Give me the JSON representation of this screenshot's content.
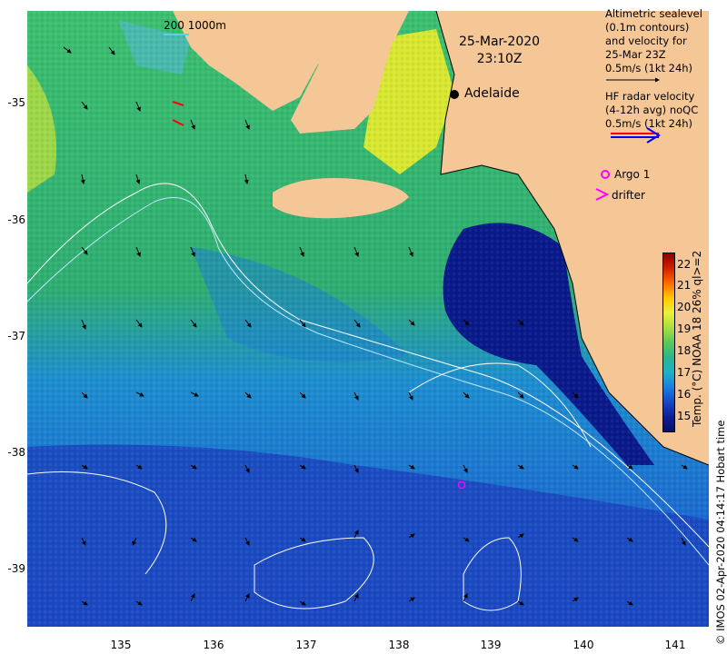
{
  "map": {
    "date": "25-Mar-2020",
    "time": "23:10Z",
    "city": "Adelaide",
    "scale_text": "200  1000m",
    "legend": {
      "altimetry_lines": [
        "Altimetric sealevel",
        "(0.1m contours)",
        "and velocity for",
        "25-Mar 23Z",
        "0.5m/s (1kt 24h)"
      ],
      "hf_lines": [
        "HF radar velocity",
        "(4-12h avg) noQC",
        "0.5m/s (1kt 24h)"
      ],
      "argo_label": "Argo 1",
      "drifter_label": "drifter"
    },
    "colorbar": {
      "title": "Temp. (°C) NOAA 18 26% ql>=2",
      "ticks": [
        "22",
        "21",
        "20",
        "19",
        "18",
        "17",
        "16",
        "15"
      ],
      "colors": [
        "#8b0000",
        "#d02000",
        "#ff6a00",
        "#ffc800",
        "#e8f03a",
        "#a8e040",
        "#5cc85a",
        "#2ab58a",
        "#1fb0c8",
        "#1a7fe0",
        "#1648c8",
        "#0e1e96",
        "#08106a"
      ]
    },
    "credit": "© IMOS 02-Apr-2020 04:14:17 Hobart time",
    "lon_ticks": [
      "135",
      "136",
      "137",
      "138",
      "139",
      "140",
      "141"
    ],
    "lat_ticks": [
      "-35",
      "-36",
      "-37",
      "-38",
      "-39"
    ],
    "colors": {
      "land": "#f5c797",
      "contour": "#ffffff",
      "argo": "#ff00ff",
      "drifter": "#ff00ff",
      "hf_red": "#ff0000",
      "hf_blue": "#0000ff"
    }
  }
}
